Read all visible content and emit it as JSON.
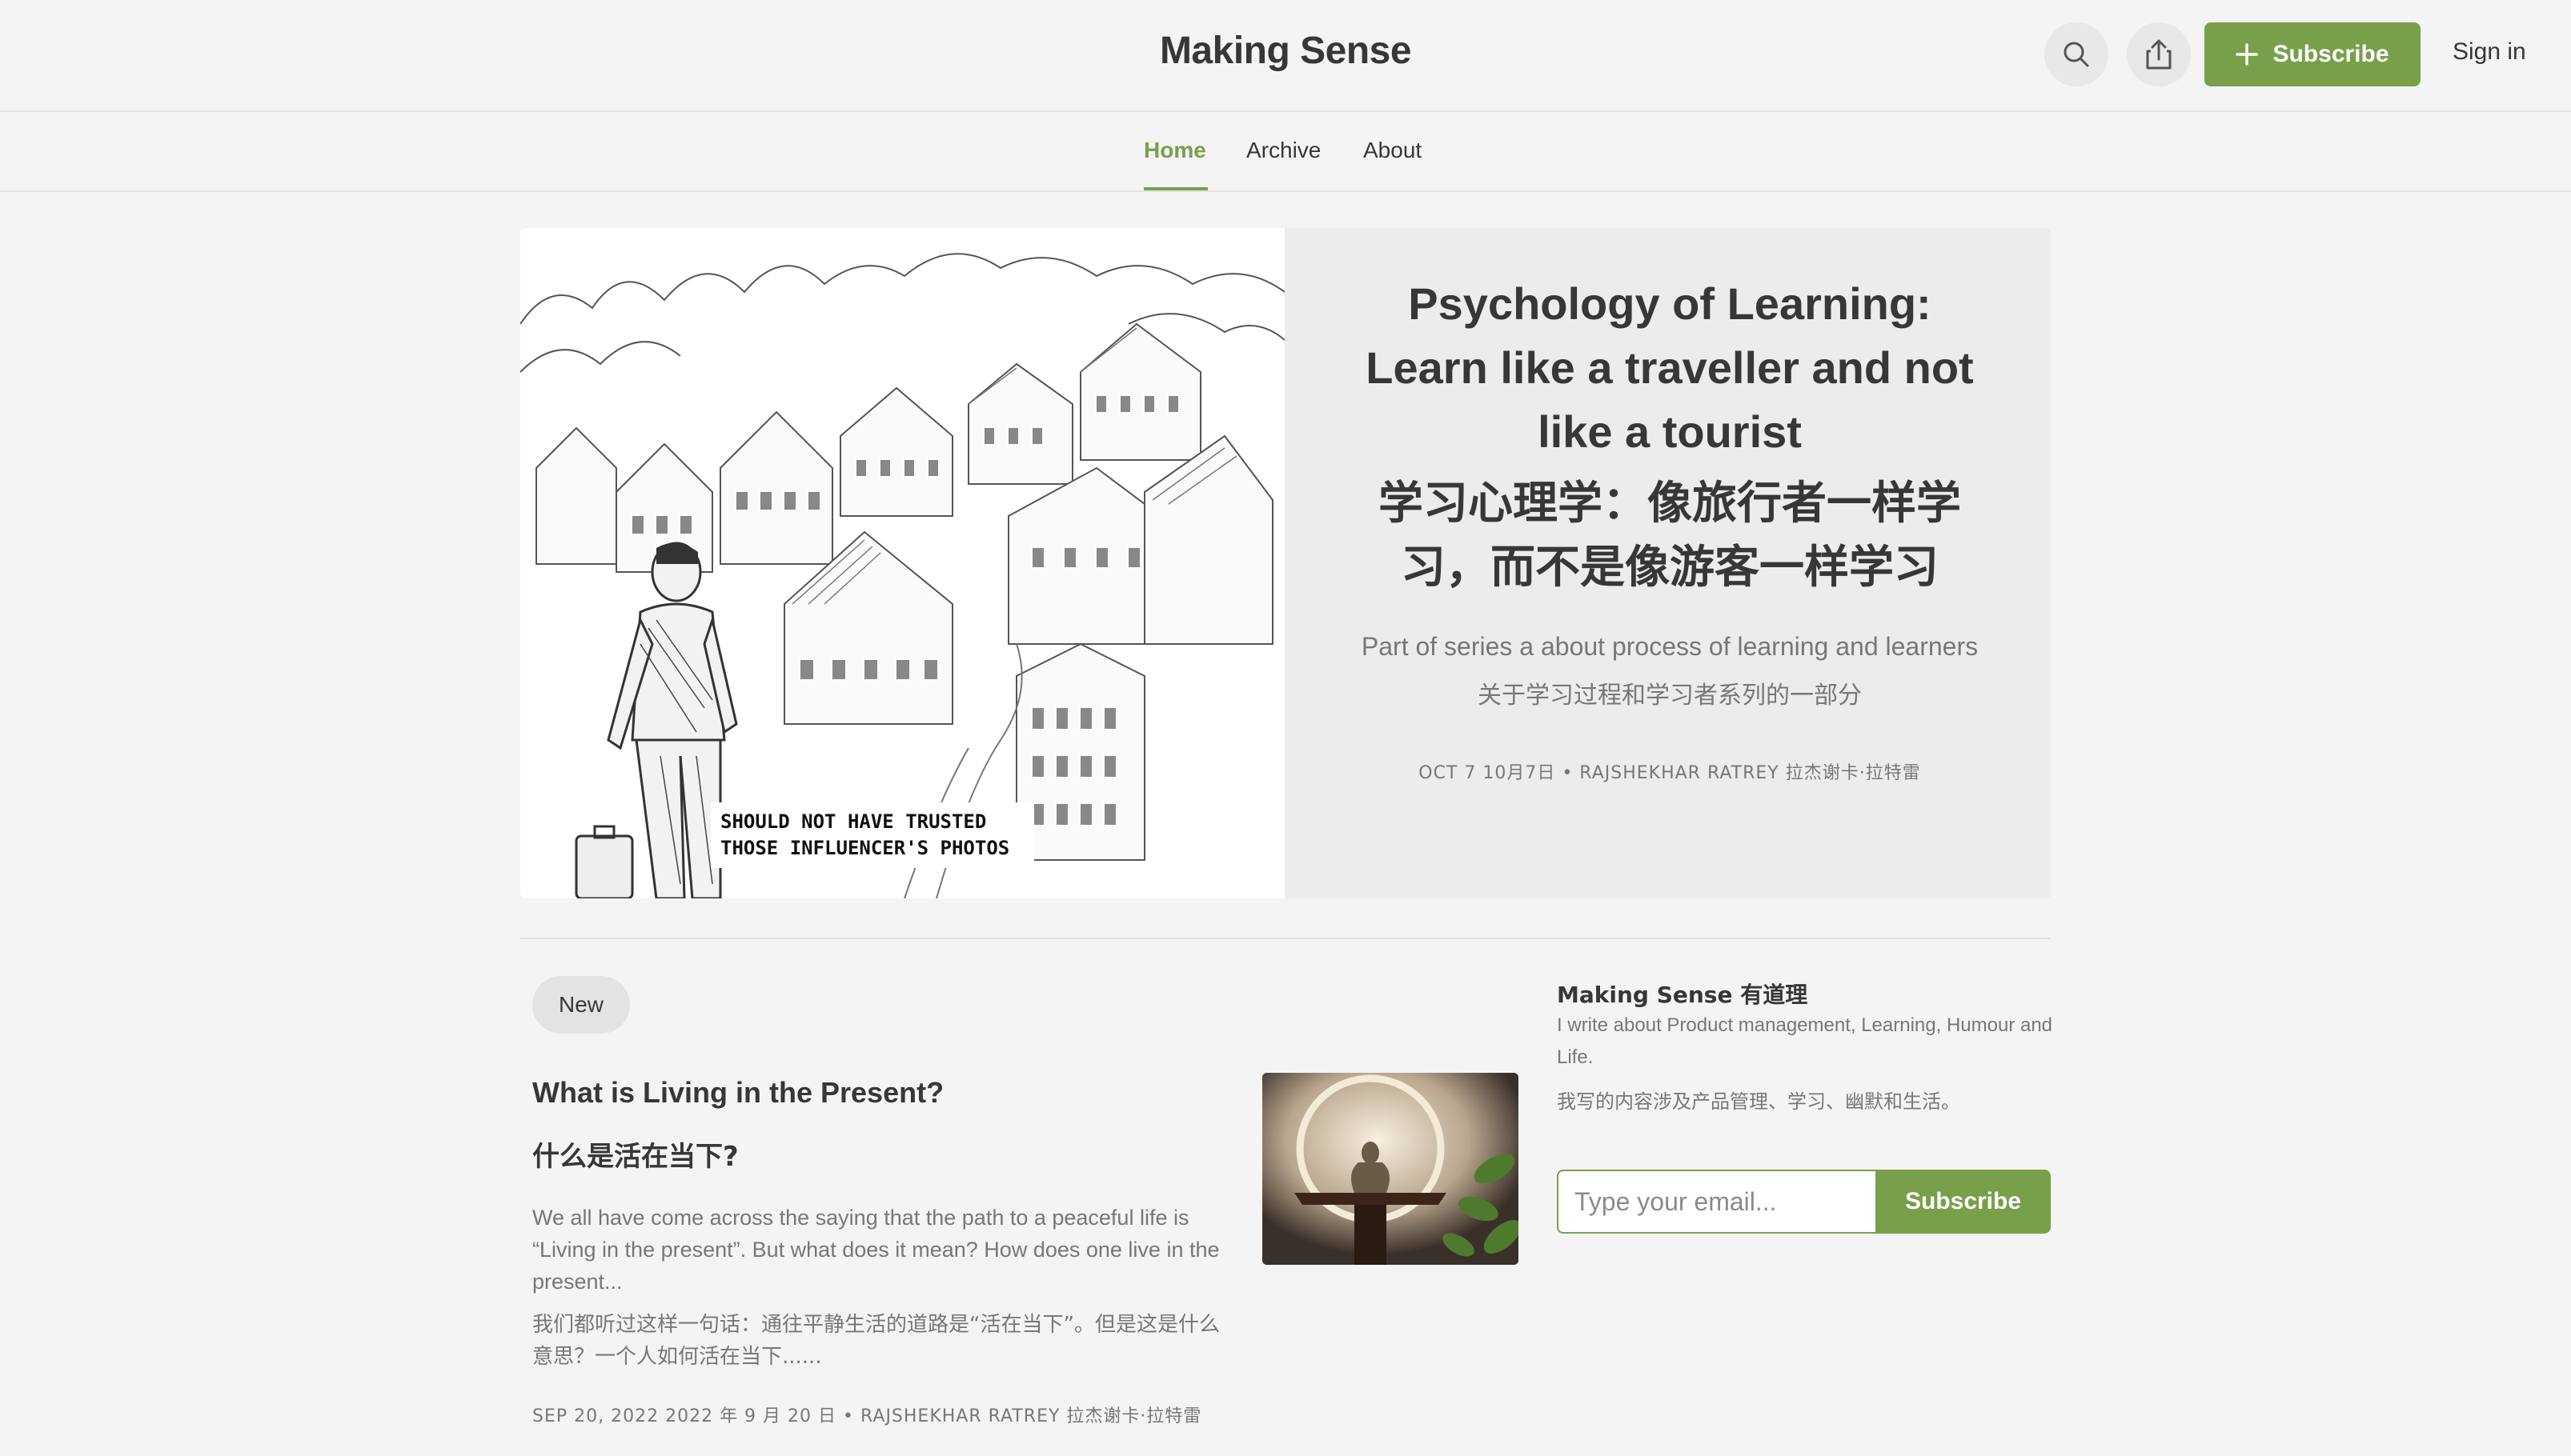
{
  "colors": {
    "accent": "#78a04b",
    "background": "#f4f4f4",
    "hero_background": "#ececec"
  },
  "header": {
    "site_title": "Making Sense",
    "search_icon": "search-icon",
    "share_icon": "share-icon",
    "subscribe_label": "Subscribe",
    "sign_in_label": "Sign in"
  },
  "nav": {
    "tabs": [
      {
        "label": "Home",
        "active": true
      },
      {
        "label": "Archive",
        "active": false
      },
      {
        "label": "About",
        "active": false
      }
    ]
  },
  "hero": {
    "image_caption_line1": "SHOULD NOT HAVE TRUSTED",
    "image_caption_line2": "THOSE INFLUENCER'S PHOTOS",
    "title": "Psychology of Learning: Learn like a traveller and not like a tourist",
    "title_zh": "学习心理学：像旅行者一样学习，而不是像游客一样学习",
    "subtitle": "Part of series a about process of learning and learners",
    "subtitle_zh": "关于学习过程和学习者系列的一部分",
    "meta": "OCT 7 10月7日 • RAJSHEKHAR RATREY  拉杰谢卡·拉特雷"
  },
  "post_list": {
    "pill_label": "New",
    "posts": [
      {
        "title": "What is Living in the Present?",
        "title_zh": "什么是活在当下?",
        "excerpt": "We all have come across the saying that the path to a peaceful life is “Living in the present”. But what does it mean? How does one live in the present...",
        "excerpt_zh": "我们都听过这样一句话：通往平静生活的道路是“活在当下”。但是这是什么意思？一个人如何活在当下......",
        "meta": "SEP 20, 2022 2022 年 9 月 20 日 • RAJSHEKHAR RATREY  拉杰谢卡·拉特雷"
      }
    ]
  },
  "sidebar": {
    "title": "Making Sense 有道理",
    "description": "I write about Product management, Learning, Humour and Life.",
    "description_zh": "我写的内容涉及产品管理、学习、幽默和生活。",
    "email_placeholder": "Type your email...",
    "subscribe_label": "Subscribe"
  }
}
